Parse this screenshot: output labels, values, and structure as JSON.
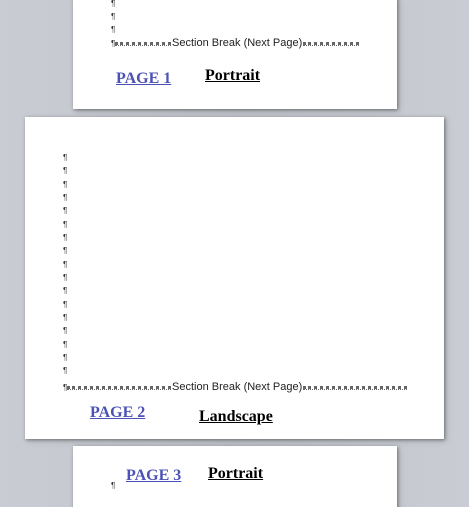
{
  "pilcrow": "¶",
  "section_break_label": "Section Break (Next Page)",
  "pages": [
    {
      "link_label": "PAGE 1",
      "orientation": "Portrait"
    },
    {
      "link_label": "PAGE 2",
      "orientation": "Landscape"
    },
    {
      "link_label": "PAGE 3",
      "orientation": "Portrait"
    }
  ],
  "colors": {
    "link": "#4b51b5",
    "workspace": "#c5c9cf",
    "page": "#ffffff"
  }
}
